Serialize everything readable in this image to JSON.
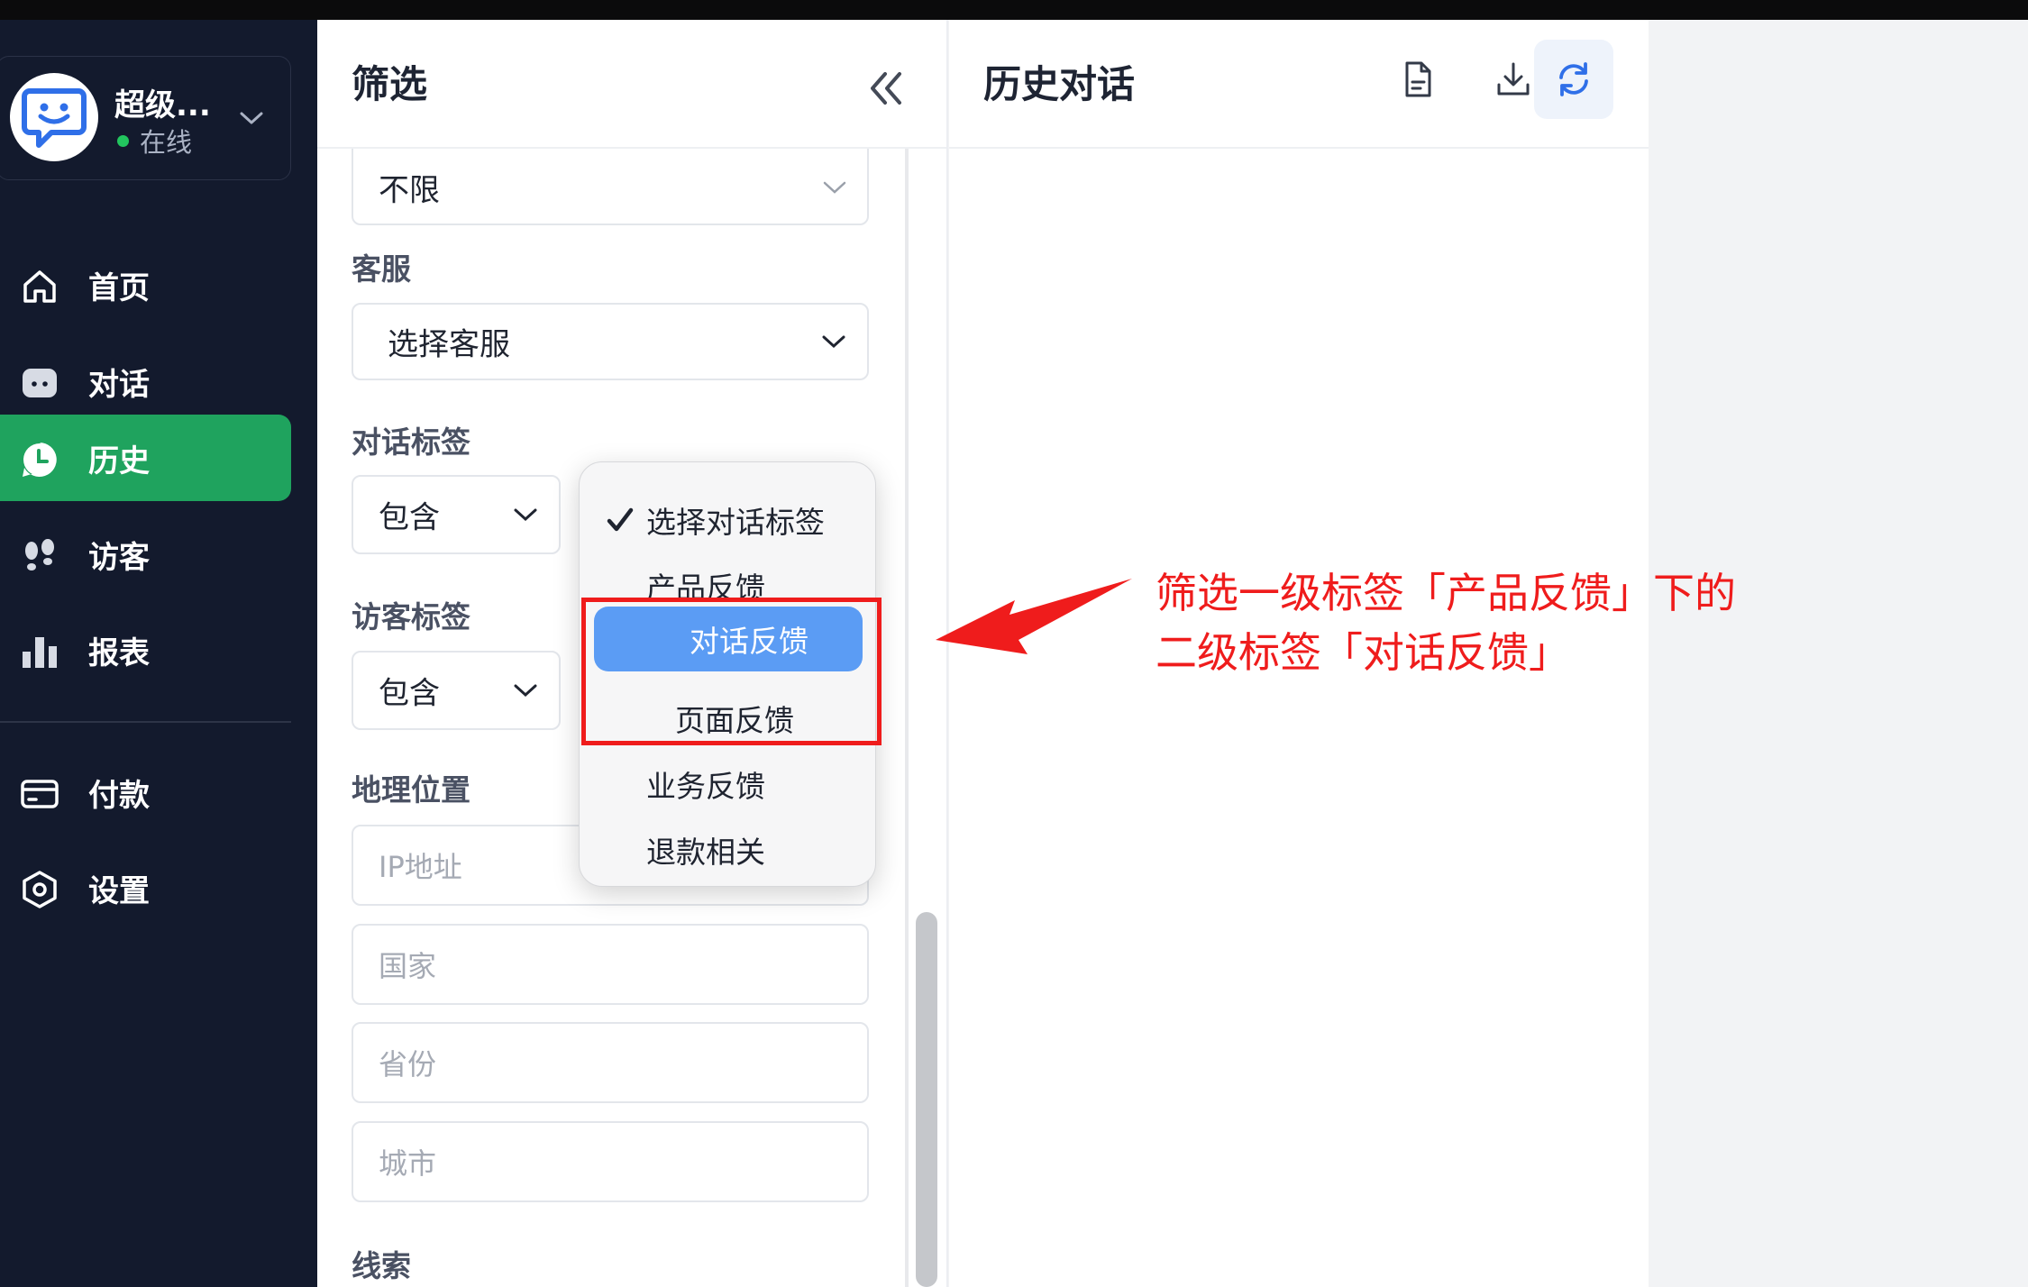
{
  "account": {
    "name": "超级...",
    "status": "在线"
  },
  "nav": {
    "items": [
      {
        "label": "首页",
        "icon": "home-icon"
      },
      {
        "label": "对话",
        "icon": "chat-icon"
      },
      {
        "label": "历史",
        "icon": "history-icon",
        "active": true
      },
      {
        "label": "访客",
        "icon": "footprint-icon"
      },
      {
        "label": "报表",
        "icon": "bar-chart-icon"
      }
    ],
    "bottom_items": [
      {
        "label": "付款",
        "icon": "credit-card-icon"
      },
      {
        "label": "设置",
        "icon": "settings-icon"
      }
    ]
  },
  "filter": {
    "title": "筛选",
    "top_select_value": "不限",
    "agent_label": "客服",
    "agent_select": "选择客服",
    "conversation_tag_label": "对话标签",
    "conversation_tag_mode": "包含",
    "visitor_tag_label": "访客标签",
    "visitor_tag_mode": "包含",
    "geo_label": "地理位置",
    "ip_placeholder": "IP地址",
    "country_placeholder": "国家",
    "province_placeholder": "省份",
    "city_placeholder": "城市",
    "leads_label": "线索"
  },
  "tag_dropdown": {
    "selected_default": "选择对话标签",
    "parent": "产品反馈",
    "highlighted": "对话反馈",
    "child_2": "页面反馈",
    "item_business": "业务反馈",
    "item_refund": "退款相关"
  },
  "history": {
    "title": "历史对话"
  },
  "annotation": {
    "line1": "筛选一级标签「产品反馈」下的",
    "line2": "二级标签「对话反馈」",
    "color": "#ef1c1c"
  },
  "colors": {
    "sidebar_bg": "#131a2d",
    "active_green": "#1fa35e",
    "highlight_blue": "#5b9cf4",
    "accent_blue": "#2f6fe8"
  }
}
